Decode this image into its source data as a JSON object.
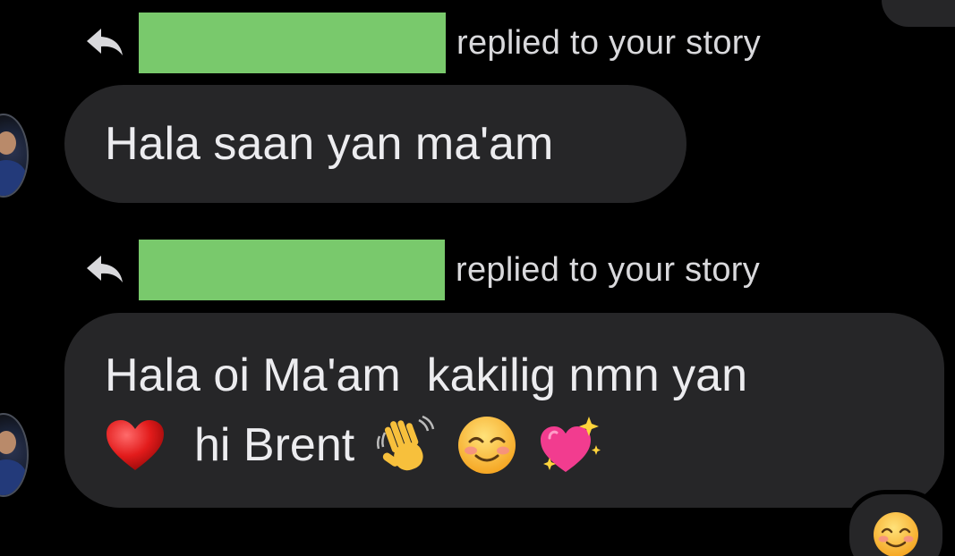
{
  "messages": [
    {
      "reply_label": "replied to your story",
      "text": "Hala saan yan ma'am"
    },
    {
      "reply_label": "replied to your story",
      "line1": "Hala oi Ma'am  kakilig nmn yan",
      "line2_text": "hi Brent"
    }
  ],
  "icons": [
    "reply-arrow-icon",
    "heart-icon",
    "waving-hand-icon",
    "smiling-face-icon",
    "sparkling-heart-icon",
    "smile-reaction-icon"
  ],
  "colors": {
    "background": "#000000",
    "bubble": "#262628",
    "text": "#ececef",
    "redaction": "#79c96c"
  }
}
